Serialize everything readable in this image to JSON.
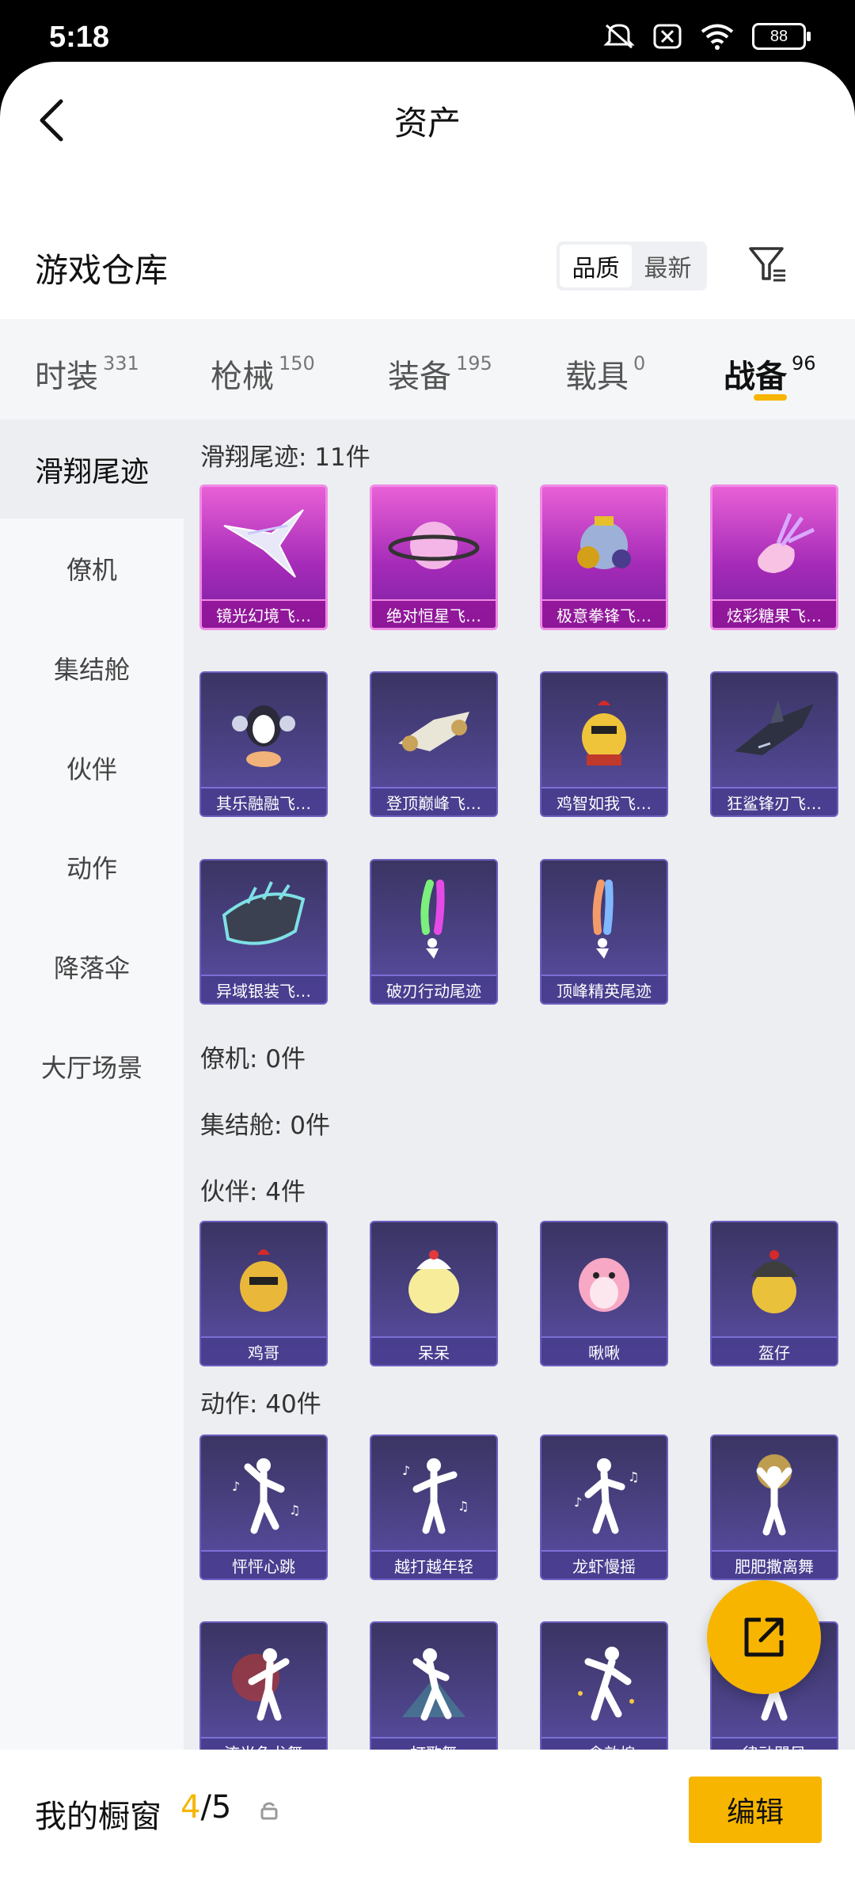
{
  "status_bar": {
    "time": "5:18",
    "battery": "88"
  },
  "header": {
    "title": "资产"
  },
  "warehouse": {
    "title": "游戏仓库",
    "sort_options": [
      "品质",
      "最新"
    ],
    "active_sort": "品质"
  },
  "tabs": [
    {
      "label": "时装",
      "count": "331"
    },
    {
      "label": "枪械",
      "count": "150"
    },
    {
      "label": "装备",
      "count": "195"
    },
    {
      "label": "载具",
      "count": "0"
    },
    {
      "label": "战备",
      "count": "96"
    }
  ],
  "active_tab": "战备",
  "sidebar": {
    "items": [
      "滑翔尾迹",
      "僚机",
      "集结舱",
      "伙伴",
      "动作",
      "降落伞",
      "大厅场景"
    ],
    "active": "滑翔尾迹"
  },
  "sections": {
    "glide": {
      "title": "滑翔尾迹: 11件",
      "items": [
        "镜光幻境飞…",
        "绝对恒星飞…",
        "极意拳锋飞…",
        "炫彩糖果飞…",
        "其乐融融飞…",
        "登顶巅峰飞…",
        "鸡智如我飞…",
        "狂鲨锋刃飞…",
        "异域银装飞…",
        "破刃行动尾迹",
        "顶峰精英尾迹"
      ]
    },
    "wingman": {
      "title": "僚机: 0件"
    },
    "capsule": {
      "title": "集结舱: 0件"
    },
    "partner": {
      "title": "伙伴: 4件",
      "items": [
        "鸡哥",
        "呆呆",
        "啾啾",
        "盔仔"
      ]
    },
    "emote": {
      "title": "动作: 40件",
      "items": [
        "怦怦心跳",
        "越打越年轻",
        "龙虾慢摇",
        "肥肥撒离舞",
        "流光鱼龙舞",
        "打歌舞",
        "一念敦煌",
        "律动飓风"
      ]
    }
  },
  "bottom_bar": {
    "label": "我的橱窗",
    "count_current": "4",
    "count_total": "/5",
    "edit_label": "编辑"
  },
  "colors": {
    "accent": "#f7b500",
    "card_pink": "#c23ec8",
    "card_purple": "#4d4389"
  }
}
